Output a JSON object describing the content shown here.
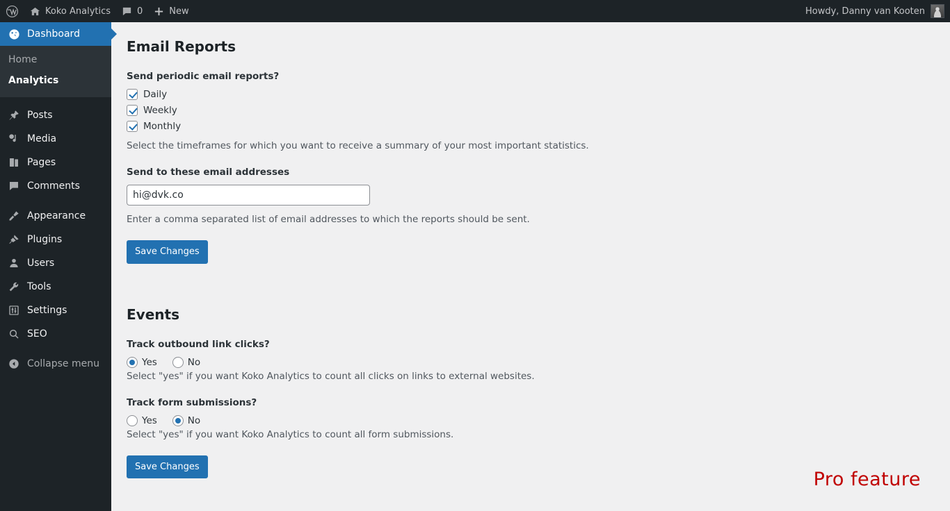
{
  "adminbar": {
    "wp_logo_icon": "wordpress-logo-icon",
    "site_icon": "home-icon",
    "site_name": "Koko Analytics",
    "comments_icon": "comment-bubble-icon",
    "comments_count": "0",
    "new_icon": "plus-icon",
    "new_label": "New",
    "howdy": "Howdy, Danny van Kooten",
    "avatar_name": "user-avatar"
  },
  "sidebar": {
    "dashboard": {
      "label": "Dashboard",
      "icon": "dashboard-gauge-icon"
    },
    "submenu": [
      {
        "label": "Home",
        "current": false
      },
      {
        "label": "Analytics",
        "current": true
      }
    ],
    "items": [
      {
        "label": "Posts",
        "icon": "pin-icon"
      },
      {
        "label": "Media",
        "icon": "media-icon"
      },
      {
        "label": "Pages",
        "icon": "pages-icon"
      },
      {
        "label": "Comments",
        "icon": "comment-bubble-icon"
      },
      {
        "label": "Appearance",
        "icon": "paintbrush-icon"
      },
      {
        "label": "Plugins",
        "icon": "plug-icon"
      },
      {
        "label": "Users",
        "icon": "user-icon"
      },
      {
        "label": "Tools",
        "icon": "wrench-icon"
      },
      {
        "label": "Settings",
        "icon": "sliders-icon"
      },
      {
        "label": "SEO",
        "icon": "search-icon"
      }
    ],
    "collapse": {
      "label": "Collapse menu",
      "icon": "collapse-arrow-icon"
    }
  },
  "email_reports": {
    "title": "Email Reports",
    "periodic_label": "Send periodic email reports?",
    "frequencies": [
      {
        "label": "Daily",
        "checked": true
      },
      {
        "label": "Weekly",
        "checked": true
      },
      {
        "label": "Monthly",
        "checked": true
      }
    ],
    "frequencies_help": "Select the timeframes for which you want to receive a summary of your most important statistics.",
    "addresses_label": "Send to these email addresses",
    "addresses_value": "hi@dvk.co",
    "addresses_placeholder": "",
    "addresses_help": "Enter a comma separated list of email addresses to which the reports should be sent.",
    "save_label": "Save Changes"
  },
  "events": {
    "title": "Events",
    "outbound_label": "Track outbound link clicks?",
    "outbound_options": [
      {
        "label": "Yes",
        "selected": true
      },
      {
        "label": "No",
        "selected": false
      }
    ],
    "outbound_help": "Select \"yes\" if you want Koko Analytics to count all clicks on links to external websites.",
    "forms_label": "Track form submissions?",
    "forms_options": [
      {
        "label": "Yes",
        "selected": false
      },
      {
        "label": "No",
        "selected": true
      }
    ],
    "forms_help": "Select \"yes\" if you want Koko Analytics to count all form submissions.",
    "save_label": "Save Changes"
  },
  "annotation": {
    "pro_feature": "Pro feature",
    "color": "#c00000"
  },
  "colors": {
    "admin_bar": "#1d2327",
    "sidebar": "#1d2327",
    "submenu": "#2c3338",
    "accent_blue": "#2271b1",
    "page_background": "#f0f0f1"
  }
}
